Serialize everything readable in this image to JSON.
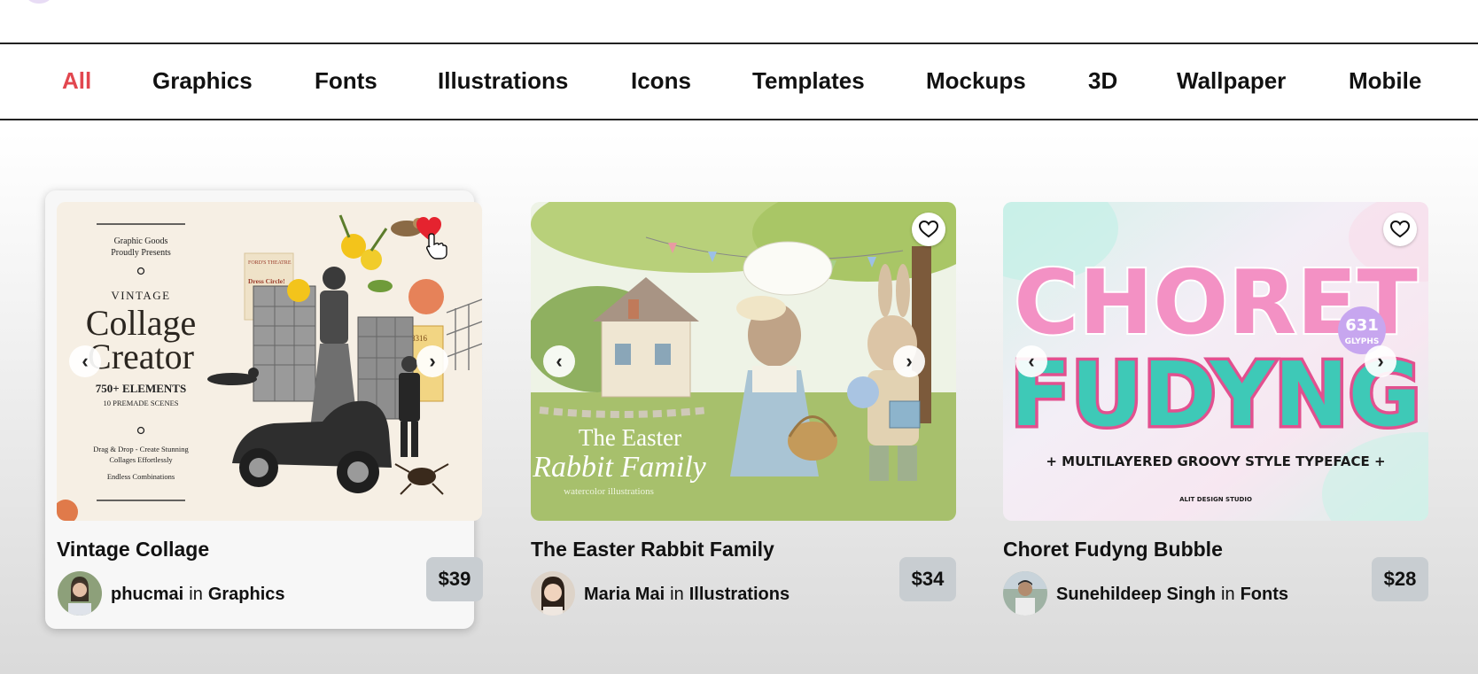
{
  "nav": {
    "active": "All",
    "items": [
      "All",
      "Graphics",
      "Fonts",
      "Illustrations",
      "Icons",
      "Templates",
      "Mockups",
      "3D",
      "Wallpaper",
      "Mobile"
    ]
  },
  "colors": {
    "accent": "#e2474f",
    "price_bg": "#c8cdd1",
    "favorited": "#e5232f"
  },
  "icons": {
    "heart": "heart-icon",
    "prev": "chevron-left-icon",
    "next": "chevron-right-icon",
    "cursor": "pointer-hand-icon"
  },
  "products": [
    {
      "title": "Vintage Collage",
      "author": "phucmai",
      "in": "in",
      "category": "Graphics",
      "price": "$39",
      "favorited": true,
      "thumb": {
        "publisher": "Graphic Goods",
        "presents": "Proudly Presents",
        "kicker": "VINTAGE",
        "headline1": "Collage",
        "headline2": "Creator",
        "elements": "750+ ELEMENTS",
        "scenes": "10 PREMADE SCENES",
        "tagline1": "Drag & Drop - Create Stunning",
        "tagline2": "Collages Effortlessly",
        "tagline3": "Endless Combinations",
        "stamp": "8316",
        "poster1": "FORD'S THEATRE",
        "poster2": "Dress Circle!"
      }
    },
    {
      "title": "The Easter Rabbit Family",
      "author": "Maria Mai",
      "in": "in",
      "category": "Illustrations",
      "price": "$34",
      "favorited": false,
      "thumb": {
        "line1": "The Easter",
        "line2": "Rabbit Family",
        "line3": "watercolor illustrations"
      }
    },
    {
      "title": "Choret Fudyng Bubble",
      "author": "Sunehildeep Singh",
      "in": "in",
      "category": "Fonts",
      "price": "$28",
      "favorited": false,
      "thumb": {
        "word1": "CHORET",
        "word2": "FUDYNG",
        "badge1": "631",
        "badge2": "GLYPHS",
        "tagline": "+ MULTILAYERED GROOVY STYLE TYPEFACE +",
        "studio": "ALIT DESIGN STUDIO"
      }
    }
  ]
}
